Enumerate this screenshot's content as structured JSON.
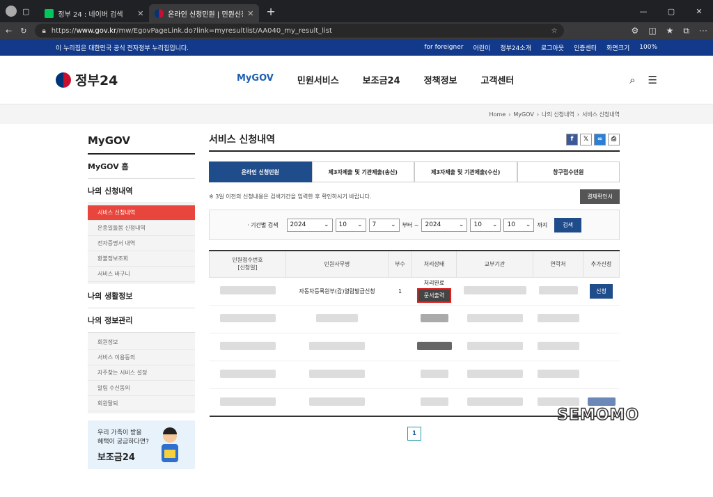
{
  "browser": {
    "tabs": [
      {
        "title": "정부 24 : 네이버 검색"
      },
      {
        "title": "온라인 신청민원 | 민원신청 내역"
      }
    ],
    "url_prefix": "https://",
    "url_domain": "www.gov.kr",
    "url_path": "/mw/EgovPageLink.do?link=myresultlist/AA040_my_result_list"
  },
  "govbar": {
    "notice": "이 누리집은 대한민국 공식 전자정부 누리집입니다.",
    "links": [
      "for foreigner",
      "어린이",
      "정부24소개",
      "로그아웃",
      "인증센터",
      "화면크기"
    ],
    "zoom": "100%"
  },
  "header": {
    "logo": "정부24",
    "nav": [
      "MyGOV",
      "민원서비스",
      "보조금24",
      "정책정보",
      "고객센터"
    ]
  },
  "breadcrumb": [
    "Home",
    "MyGOV",
    "나의 신청내역",
    "서비스 신청내역"
  ],
  "lnb": {
    "title": "MyGOV",
    "home": "MyGOV 홈",
    "group1": "나의 신청내역",
    "sub1": [
      "서비스 신청내역",
      "온종일돌봄 신청내역",
      "전자증명서 내역",
      "환불정보조회",
      "서비스 바구니"
    ],
    "group2": "나의 생활정보",
    "group3": "나의 정보관리",
    "sub3": [
      "회원정보",
      "서비스 이용동의",
      "자주찾는 서비스 설정",
      "알림 수신동의",
      "회원탈퇴"
    ],
    "banner_l1": "우리 가족이 받을",
    "banner_l2": "혜택이 궁금하다면?",
    "banner_l3": "보조금24"
  },
  "main": {
    "title": "서비스 신청내역",
    "tabs": [
      "온라인 신청민원",
      "제3자제출 및 기관제출(송신)",
      "제3자제출 및 기관제출(수신)",
      "창구접수민원"
    ],
    "notice": "※ 3일 이전의 신청내용은 검색기간을 입력한 후 확인하시기 바랍니다.",
    "pay_button": "결제확인서",
    "filter_label": "· 기간별 검색",
    "from": {
      "year": "2024",
      "month": "10",
      "day": "7"
    },
    "from_suffix": "부터 ~",
    "to": {
      "year": "2024",
      "month": "10",
      "day": "10"
    },
    "to_suffix": "까지",
    "search_button": "검색",
    "columns": [
      "민원접수번호\n[신청일]",
      "민원사무명",
      "부수",
      "처리상태",
      "교부기관",
      "연락처",
      "추가신청"
    ],
    "row": {
      "service": "자동차등록원부(갑)열람발급신청",
      "copies": "1",
      "status": "처리완료",
      "print_button": "문서출력",
      "apply_button": "신청"
    },
    "page": "1"
  },
  "watermark": "SEMOMO"
}
